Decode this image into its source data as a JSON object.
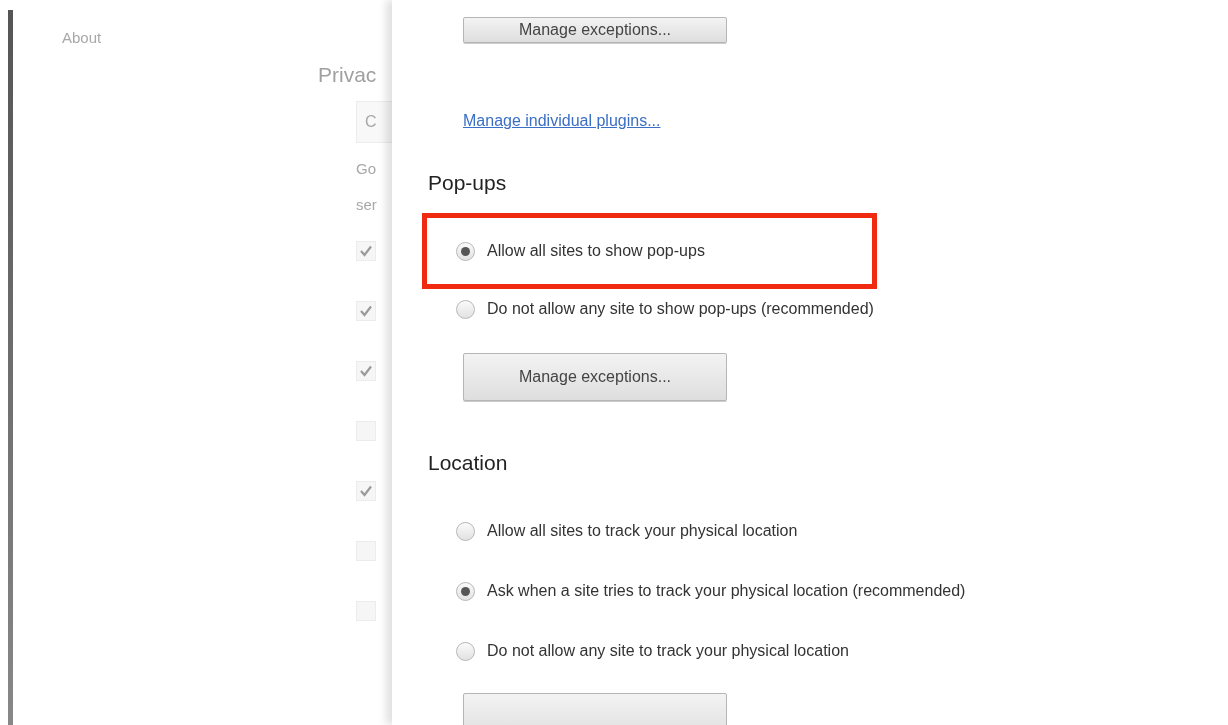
{
  "background_page": {
    "sidebar": {
      "items": [
        "About"
      ]
    },
    "section_title": "Privac",
    "button": "C",
    "text_lines": [
      "Go",
      "ser"
    ],
    "checkboxes": [
      {
        "checked": true
      },
      {
        "checked": true
      },
      {
        "checked": true
      },
      {
        "checked": false
      },
      {
        "checked": true
      },
      {
        "checked": false
      },
      {
        "checked": false
      }
    ]
  },
  "dialog": {
    "top_button": "Manage exceptions...",
    "link": "Manage individual plugins...",
    "sections": [
      {
        "heading": "Pop-ups",
        "options": [
          {
            "label": "Allow all sites to show pop-ups",
            "selected": true,
            "highlighted": true
          },
          {
            "label": "Do not allow any site to show pop-ups (recommended)",
            "selected": false,
            "highlighted": false
          }
        ],
        "button": "Manage exceptions..."
      },
      {
        "heading": "Location",
        "options": [
          {
            "label": "Allow all sites to track your physical location",
            "selected": false,
            "highlighted": false
          },
          {
            "label": "Ask when a site tries to track your physical location (recommended)",
            "selected": true,
            "highlighted": false
          },
          {
            "label": "Do not allow any site to track your physical location",
            "selected": false,
            "highlighted": false
          }
        ]
      }
    ]
  }
}
